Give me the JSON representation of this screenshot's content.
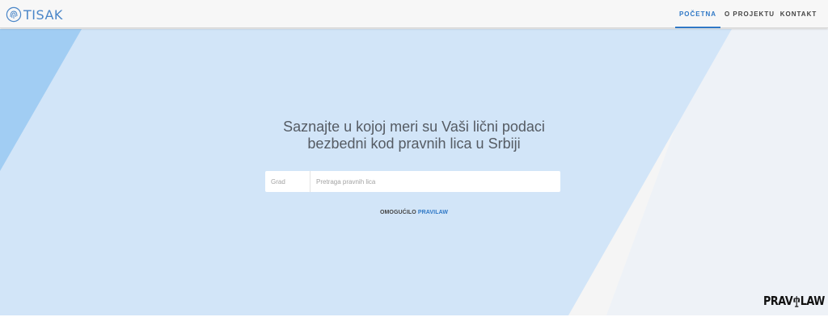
{
  "header": {
    "logo_text": "TISAK",
    "nav": [
      {
        "label": "POČETNA",
        "active": true
      },
      {
        "label": "O PROJEKTU",
        "active": false
      },
      {
        "label": "KONTAKT",
        "active": false
      }
    ]
  },
  "hero": {
    "headline_line1": "Saznajte u kojoj meri su Vaši lični podaci",
    "headline_line2": "bezbedni kod pravnih lica u Srbiji",
    "search": {
      "city_label": "Grad",
      "placeholder": "Pretraga pravnih lica"
    },
    "powered_by_prefix": "OMOGUĆILO",
    "powered_by_link": "PRAVILAW"
  },
  "brand": {
    "text_left": "PRAV",
    "text_right": "LAW"
  },
  "colors": {
    "accent": "#2f78c6",
    "hero_blue": "#d2e5f8",
    "hero_stripe": "#a1cdf3",
    "hero_light": "#eef2f7"
  }
}
